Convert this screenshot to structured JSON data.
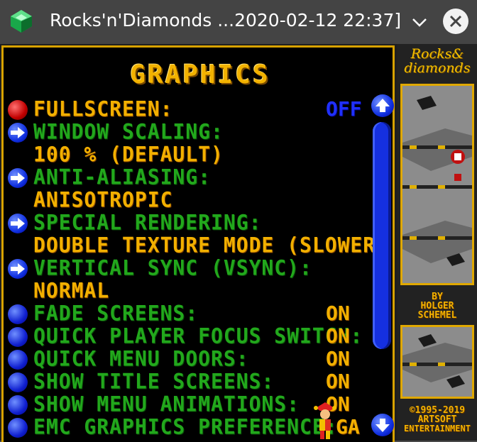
{
  "window": {
    "title": "Rocks'n'Diamonds ...2020-02-12 22:37]"
  },
  "screen": {
    "heading": "GRAPHICS"
  },
  "options": [
    {
      "label": "FULLSCREEN:",
      "value": "OFF"
    },
    {
      "label": "WINDOW SCALING:",
      "value": "100 % (DEFAULT)"
    },
    {
      "label": "ANTI-ALIASING:",
      "value": "ANISOTROPIC"
    },
    {
      "label": "SPECIAL RENDERING:",
      "value": "DOUBLE TEXTURE MODE (SLOWER)"
    },
    {
      "label": "VERTICAL SYNC (VSYNC):",
      "value": "NORMAL"
    },
    {
      "label": "FADE SCREENS:",
      "value": "ON"
    },
    {
      "label": "QUICK PLAYER FOCUS SWITCH:",
      "value": "ON"
    },
    {
      "label": "QUICK MENU DOORS:",
      "value": "ON"
    },
    {
      "label": "SHOW TITLE SCREENS:",
      "value": "ON"
    },
    {
      "label": "SHOW MENU ANIMATIONS:",
      "value": "ON"
    },
    {
      "label": "EMC GRAPHICS PREFERENCE:",
      "value": "GA"
    }
  ],
  "sidebar": {
    "logo_line1": "Rocks&",
    "logo_line2": "diamonds",
    "by": "BY",
    "author1": "HOLGER",
    "author2": "SCHEMEL",
    "copyright": "©1995-2019",
    "company1": "ARTSOFT",
    "company2": "ENTERTAINMENT"
  },
  "colors": {
    "accent_gold": "#f2b000",
    "label_green": "#22a81c",
    "value_blue": "#2030ff",
    "frame": "#d8a200"
  }
}
